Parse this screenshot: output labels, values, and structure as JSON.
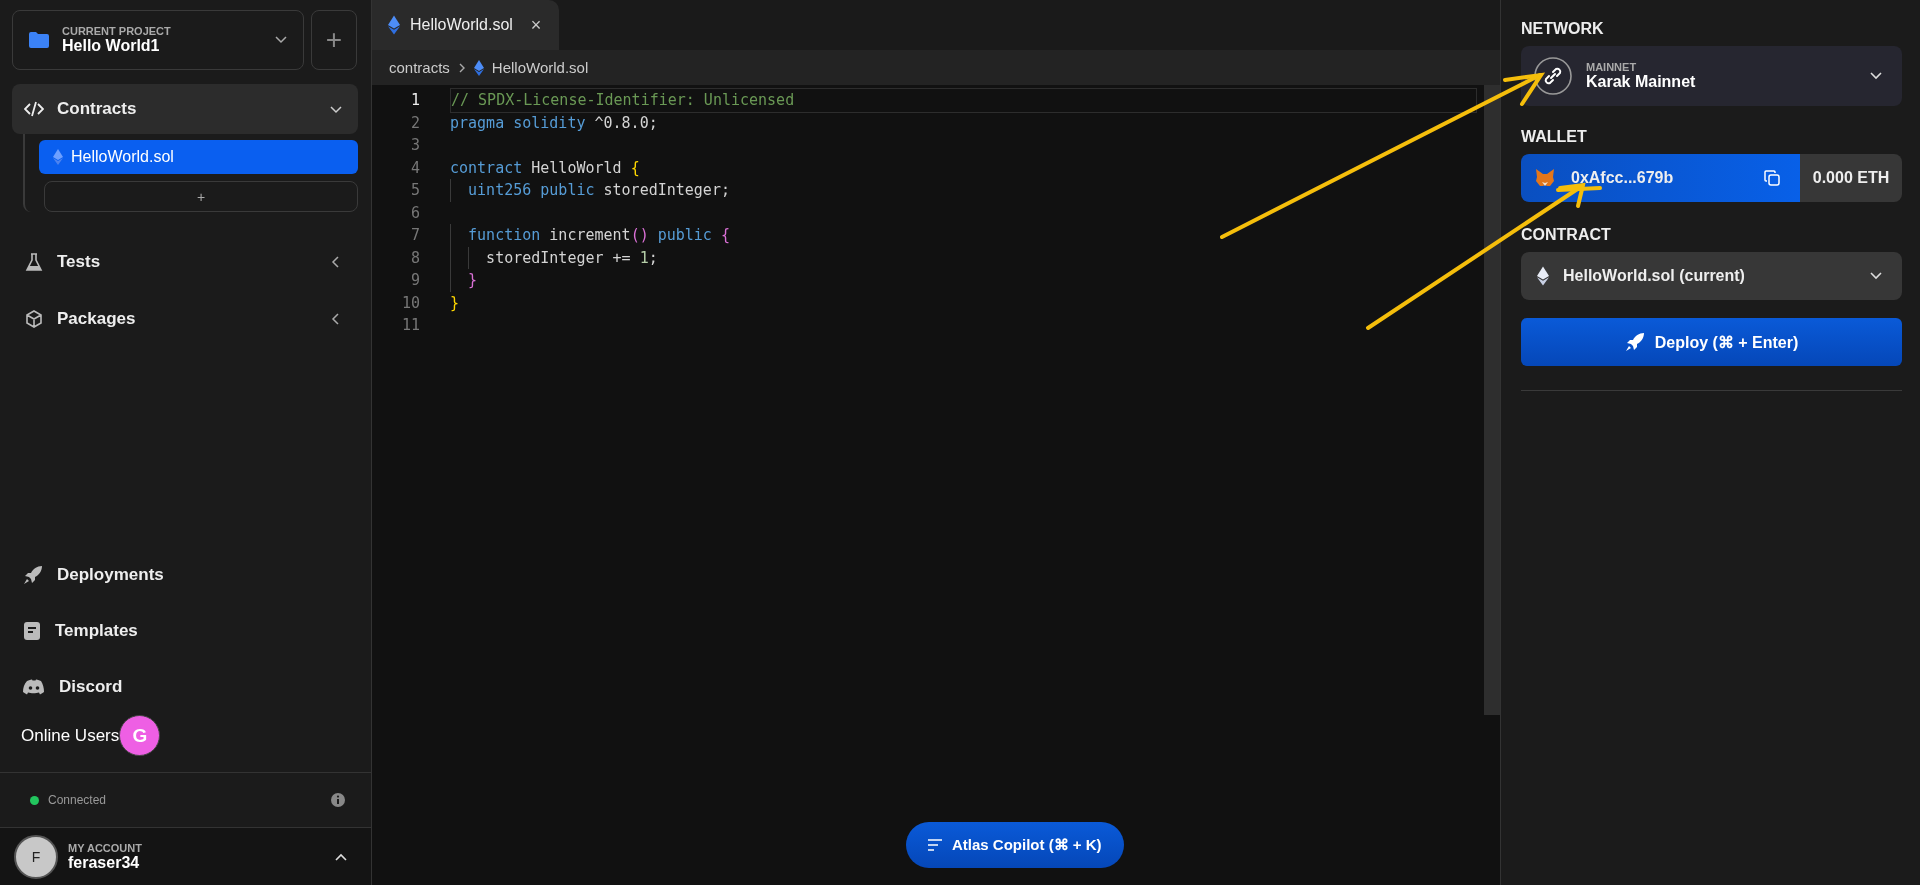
{
  "sidebar": {
    "project": {
      "label": "CURRENT PROJECT",
      "name": "Hello World1",
      "add_button": "+"
    },
    "sections": [
      {
        "label": "Contracts",
        "expanded": true,
        "children": [
          {
            "label": "HelloWorld.sol",
            "selected": true
          }
        ],
        "add_button": "+"
      },
      {
        "label": "Tests",
        "expanded": false
      },
      {
        "label": "Packages",
        "expanded": false
      }
    ],
    "links": [
      {
        "label": "Deployments"
      },
      {
        "label": "Templates"
      },
      {
        "label": "Discord"
      }
    ],
    "online_users": {
      "label": "Online Users",
      "users": [
        {
          "initial": "G",
          "color": "#ee5fe4"
        }
      ]
    },
    "status": {
      "label": "Connected",
      "connected": true
    },
    "account": {
      "label": "MY ACCOUNT",
      "name": "feraser34",
      "initial": "F",
      "expanded": false
    }
  },
  "editor": {
    "tabs": [
      {
        "label": "HelloWorld.sol",
        "close": "×",
        "selected": true
      }
    ],
    "breadcrumb": [
      "contracts",
      "HelloWorld.sol"
    ],
    "lines": [
      {
        "number": "1",
        "current": true,
        "tokens": [
          {
            "text": "// SPDX-License-Identifier: Unlicensed",
            "kind": "comment"
          }
        ]
      },
      {
        "number": "2",
        "current": false,
        "tokens": [
          {
            "text": "pragma solidity",
            "kind": "keyword"
          },
          {
            "text": " ^0.8.0;",
            "kind": "plain"
          }
        ]
      },
      {
        "number": "3",
        "current": false
      },
      {
        "number": "4",
        "current": false,
        "tokens": [
          {
            "text": "contract",
            "kind": "keyword"
          },
          {
            "text": " HelloWorld ",
            "kind": "plain"
          },
          {
            "text": "{",
            "kind": "brace1"
          }
        ]
      },
      {
        "number": "5",
        "current": false,
        "tokens": [
          {
            "text": "  uint256 public",
            "kind": "keyword"
          },
          {
            "text": " storedInteger;",
            "kind": "plain"
          }
        ]
      },
      {
        "number": "6",
        "current": false
      },
      {
        "number": "7",
        "current": false,
        "tokens": [
          {
            "text": "  function",
            "kind": "keyword"
          },
          {
            "text": " increment",
            "kind": "plain"
          },
          {
            "text": "()",
            "kind": "brace2"
          },
          {
            "text": " public ",
            "kind": "keyword"
          },
          {
            "text": "{",
            "kind": "brace2"
          }
        ]
      },
      {
        "number": "8",
        "current": false,
        "tokens": [
          {
            "text": "    storedInteger += ",
            "kind": "plain"
          },
          {
            "text": "1",
            "kind": "number"
          },
          {
            "text": ";",
            "kind": "plain"
          }
        ]
      },
      {
        "number": "9",
        "current": false,
        "tokens": [
          {
            "text": "  }",
            "kind": "brace2"
          }
        ]
      },
      {
        "number": "10",
        "current": false,
        "tokens": [
          {
            "text": "}",
            "kind": "brace1"
          }
        ]
      },
      {
        "number": "11",
        "current": false
      }
    ],
    "copilot_button": "Atlas Copilot (⌘ + K)"
  },
  "deploy_panel": {
    "network_label": "NETWORK",
    "network": {
      "caption": "MAINNET",
      "name": "Karak Mainnet"
    },
    "wallet_label": "WALLET",
    "wallet": {
      "address": "0xAfcc...679b",
      "balance": "0.000 ETH"
    },
    "contract_label": "CONTRACT",
    "contract": "HelloWorld.sol (current)",
    "deploy_button": "Deploy (⌘ + Enter)"
  }
}
